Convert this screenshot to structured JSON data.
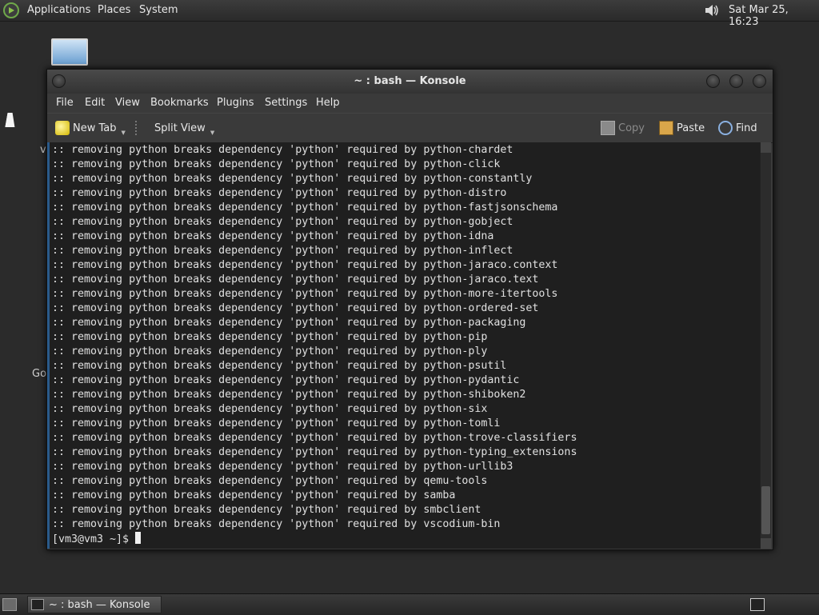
{
  "top_panel": {
    "menus": [
      "Applications",
      "Places",
      "System"
    ],
    "clock": "Sat Mar 25, 16:23"
  },
  "desktop": {
    "icon_label_stubs": [
      "vi",
      "Go"
    ]
  },
  "window": {
    "title": "~ : bash — Konsole",
    "menubar": [
      "File",
      "Edit",
      "View",
      "Bookmarks",
      "Plugins",
      "Settings",
      "Help"
    ],
    "toolbar": {
      "new_tab": "New Tab",
      "split_view": "Split View",
      "copy": "Copy",
      "paste": "Paste",
      "find": "Find"
    }
  },
  "terminal": {
    "lines": [
      ":: removing python breaks dependency 'python' required by python-chardet",
      ":: removing python breaks dependency 'python' required by python-click",
      ":: removing python breaks dependency 'python' required by python-constantly",
      ":: removing python breaks dependency 'python' required by python-distro",
      ":: removing python breaks dependency 'python' required by python-fastjsonschema",
      ":: removing python breaks dependency 'python' required by python-gobject",
      ":: removing python breaks dependency 'python' required by python-idna",
      ":: removing python breaks dependency 'python' required by python-inflect",
      ":: removing python breaks dependency 'python' required by python-jaraco.context",
      ":: removing python breaks dependency 'python' required by python-jaraco.text",
      ":: removing python breaks dependency 'python' required by python-more-itertools",
      ":: removing python breaks dependency 'python' required by python-ordered-set",
      ":: removing python breaks dependency 'python' required by python-packaging",
      ":: removing python breaks dependency 'python' required by python-pip",
      ":: removing python breaks dependency 'python' required by python-ply",
      ":: removing python breaks dependency 'python' required by python-psutil",
      ":: removing python breaks dependency 'python' required by python-pydantic",
      ":: removing python breaks dependency 'python' required by python-shiboken2",
      ":: removing python breaks dependency 'python' required by python-six",
      ":: removing python breaks dependency 'python' required by python-tomli",
      ":: removing python breaks dependency 'python' required by python-trove-classifiers",
      ":: removing python breaks dependency 'python' required by python-typing_extensions",
      ":: removing python breaks dependency 'python' required by python-urllib3",
      ":: removing python breaks dependency 'python' required by qemu-tools",
      ":: removing python breaks dependency 'python' required by samba",
      ":: removing python breaks dependency 'python' required by smbclient",
      ":: removing python breaks dependency 'python' required by vscodium-bin"
    ],
    "prompt": "[vm3@vm3 ~]$ "
  },
  "bottom_panel": {
    "task_label": "~ : bash — Konsole"
  }
}
